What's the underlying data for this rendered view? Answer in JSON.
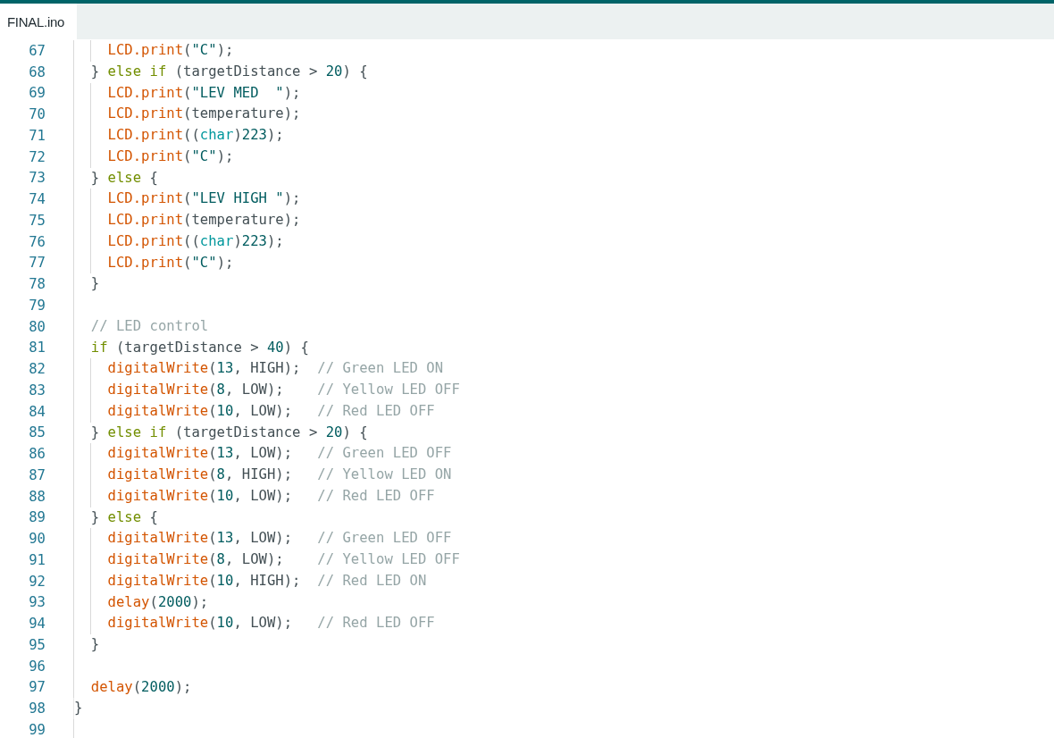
{
  "tabs": [
    {
      "label": "FINAL.ino",
      "selected": true
    }
  ],
  "lines": [
    {
      "number": "67",
      "tokens": [
        {
          "kind": "function",
          "text": "    LCD.print"
        },
        {
          "kind": "plain",
          "text": "("
        },
        {
          "kind": "string",
          "text": "\"C\""
        },
        {
          "kind": "plain",
          "text": ");"
        }
      ]
    },
    {
      "number": "68",
      "tokens": [
        {
          "kind": "plain",
          "text": "  } "
        },
        {
          "kind": "keyword",
          "text": "else if"
        },
        {
          "kind": "plain",
          "text": " (targetDistance > "
        },
        {
          "kind": "number",
          "text": "20"
        },
        {
          "kind": "plain",
          "text": ") {"
        }
      ]
    },
    {
      "number": "69",
      "tokens": [
        {
          "kind": "function",
          "text": "    LCD.print"
        },
        {
          "kind": "plain",
          "text": "("
        },
        {
          "kind": "string",
          "text": "\"LEV MED  \""
        },
        {
          "kind": "plain",
          "text": ");"
        }
      ]
    },
    {
      "number": "70",
      "tokens": [
        {
          "kind": "function",
          "text": "    LCD.print"
        },
        {
          "kind": "plain",
          "text": "(temperature);"
        }
      ]
    },
    {
      "number": "71",
      "tokens": [
        {
          "kind": "function",
          "text": "    LCD.print"
        },
        {
          "kind": "plain",
          "text": "(("
        },
        {
          "kind": "type",
          "text": "char"
        },
        {
          "kind": "plain",
          "text": ")"
        },
        {
          "kind": "number",
          "text": "223"
        },
        {
          "kind": "plain",
          "text": ");"
        }
      ]
    },
    {
      "number": "72",
      "tokens": [
        {
          "kind": "function",
          "text": "    LCD.print"
        },
        {
          "kind": "plain",
          "text": "("
        },
        {
          "kind": "string",
          "text": "\"C\""
        },
        {
          "kind": "plain",
          "text": ");"
        }
      ]
    },
    {
      "number": "73",
      "tokens": [
        {
          "kind": "plain",
          "text": "  } "
        },
        {
          "kind": "keyword",
          "text": "else"
        },
        {
          "kind": "plain",
          "text": " {"
        }
      ]
    },
    {
      "number": "74",
      "tokens": [
        {
          "kind": "function",
          "text": "    LCD.print"
        },
        {
          "kind": "plain",
          "text": "("
        },
        {
          "kind": "string",
          "text": "\"LEV HIGH \""
        },
        {
          "kind": "plain",
          "text": ");"
        }
      ]
    },
    {
      "number": "75",
      "tokens": [
        {
          "kind": "function",
          "text": "    LCD.print"
        },
        {
          "kind": "plain",
          "text": "(temperature);"
        }
      ]
    },
    {
      "number": "76",
      "tokens": [
        {
          "kind": "function",
          "text": "    LCD.print"
        },
        {
          "kind": "plain",
          "text": "(("
        },
        {
          "kind": "type",
          "text": "char"
        },
        {
          "kind": "plain",
          "text": ")"
        },
        {
          "kind": "number",
          "text": "223"
        },
        {
          "kind": "plain",
          "text": ");"
        }
      ]
    },
    {
      "number": "77",
      "tokens": [
        {
          "kind": "function",
          "text": "    LCD.print"
        },
        {
          "kind": "plain",
          "text": "("
        },
        {
          "kind": "string",
          "text": "\"C\""
        },
        {
          "kind": "plain",
          "text": ");"
        }
      ]
    },
    {
      "number": "78",
      "tokens": [
        {
          "kind": "plain",
          "text": "  }"
        }
      ]
    },
    {
      "number": "79"
    },
    {
      "number": "80",
      "tokens": [
        {
          "kind": "comment",
          "text": "  // LED control"
        }
      ]
    },
    {
      "number": "81",
      "tokens": [
        {
          "kind": "keyword",
          "text": "  if"
        },
        {
          "kind": "plain",
          "text": " (targetDistance > "
        },
        {
          "kind": "number",
          "text": "40"
        },
        {
          "kind": "plain",
          "text": ") {"
        }
      ]
    },
    {
      "number": "82",
      "tokens": [
        {
          "kind": "function",
          "text": "    digitalWrite"
        },
        {
          "kind": "plain",
          "text": "("
        },
        {
          "kind": "number",
          "text": "13"
        },
        {
          "kind": "plain",
          "text": ", HIGH);"
        },
        {
          "kind": "comment",
          "text": "  // Green LED ON"
        }
      ]
    },
    {
      "number": "83",
      "tokens": [
        {
          "kind": "function",
          "text": "    digitalWrite"
        },
        {
          "kind": "plain",
          "text": "("
        },
        {
          "kind": "number",
          "text": "8"
        },
        {
          "kind": "plain",
          "text": ", LOW);"
        },
        {
          "kind": "comment",
          "text": "    // Yellow LED OFF"
        }
      ]
    },
    {
      "number": "84",
      "tokens": [
        {
          "kind": "function",
          "text": "    digitalWrite"
        },
        {
          "kind": "plain",
          "text": "("
        },
        {
          "kind": "number",
          "text": "10"
        },
        {
          "kind": "plain",
          "text": ", LOW);"
        },
        {
          "kind": "comment",
          "text": "   // Red LED OFF"
        }
      ]
    },
    {
      "number": "85",
      "tokens": [
        {
          "kind": "plain",
          "text": "  } "
        },
        {
          "kind": "keyword",
          "text": "else if"
        },
        {
          "kind": "plain",
          "text": " (targetDistance > "
        },
        {
          "kind": "number",
          "text": "20"
        },
        {
          "kind": "plain",
          "text": ") {"
        }
      ]
    },
    {
      "number": "86",
      "tokens": [
        {
          "kind": "function",
          "text": "    digitalWrite"
        },
        {
          "kind": "plain",
          "text": "("
        },
        {
          "kind": "number",
          "text": "13"
        },
        {
          "kind": "plain",
          "text": ", LOW);"
        },
        {
          "kind": "comment",
          "text": "   // Green LED OFF"
        }
      ]
    },
    {
      "number": "87",
      "tokens": [
        {
          "kind": "function",
          "text": "    digitalWrite"
        },
        {
          "kind": "plain",
          "text": "("
        },
        {
          "kind": "number",
          "text": "8"
        },
        {
          "kind": "plain",
          "text": ", HIGH);"
        },
        {
          "kind": "comment",
          "text": "   // Yellow LED ON"
        }
      ]
    },
    {
      "number": "88",
      "tokens": [
        {
          "kind": "function",
          "text": "    digitalWrite"
        },
        {
          "kind": "plain",
          "text": "("
        },
        {
          "kind": "number",
          "text": "10"
        },
        {
          "kind": "plain",
          "text": ", LOW);"
        },
        {
          "kind": "comment",
          "text": "   // Red LED OFF"
        }
      ]
    },
    {
      "number": "89",
      "tokens": [
        {
          "kind": "plain",
          "text": "  } "
        },
        {
          "kind": "keyword",
          "text": "else"
        },
        {
          "kind": "plain",
          "text": " {"
        }
      ]
    },
    {
      "number": "90",
      "tokens": [
        {
          "kind": "function",
          "text": "    digitalWrite"
        },
        {
          "kind": "plain",
          "text": "("
        },
        {
          "kind": "number",
          "text": "13"
        },
        {
          "kind": "plain",
          "text": ", LOW);"
        },
        {
          "kind": "comment",
          "text": "   // Green LED OFF"
        }
      ]
    },
    {
      "number": "91",
      "tokens": [
        {
          "kind": "function",
          "text": "    digitalWrite"
        },
        {
          "kind": "plain",
          "text": "("
        },
        {
          "kind": "number",
          "text": "8"
        },
        {
          "kind": "plain",
          "text": ", LOW);"
        },
        {
          "kind": "comment",
          "text": "    // Yellow LED OFF"
        }
      ]
    },
    {
      "number": "92",
      "tokens": [
        {
          "kind": "function",
          "text": "    digitalWrite"
        },
        {
          "kind": "plain",
          "text": "("
        },
        {
          "kind": "number",
          "text": "10"
        },
        {
          "kind": "plain",
          "text": ", HIGH);"
        },
        {
          "kind": "comment",
          "text": "  // Red LED ON"
        }
      ]
    },
    {
      "number": "93",
      "tokens": [
        {
          "kind": "function",
          "text": "    delay"
        },
        {
          "kind": "plain",
          "text": "("
        },
        {
          "kind": "number",
          "text": "2000"
        },
        {
          "kind": "plain",
          "text": ");"
        }
      ]
    },
    {
      "number": "94",
      "tokens": [
        {
          "kind": "function",
          "text": "    digitalWrite"
        },
        {
          "kind": "plain",
          "text": "("
        },
        {
          "kind": "number",
          "text": "10"
        },
        {
          "kind": "plain",
          "text": ", LOW);"
        },
        {
          "kind": "comment",
          "text": "   // Red LED OFF"
        }
      ]
    },
    {
      "number": "95",
      "tokens": [
        {
          "kind": "plain",
          "text": "  }"
        }
      ]
    },
    {
      "number": "96"
    },
    {
      "number": "97",
      "tokens": [
        {
          "kind": "function",
          "text": "  delay"
        },
        {
          "kind": "plain",
          "text": "("
        },
        {
          "kind": "number",
          "text": "2000"
        },
        {
          "kind": "plain",
          "text": ");"
        }
      ]
    },
    {
      "number": "98",
      "tokens": [
        {
          "kind": "plain",
          "text": "}"
        }
      ]
    },
    {
      "number": "99"
    }
  ]
}
